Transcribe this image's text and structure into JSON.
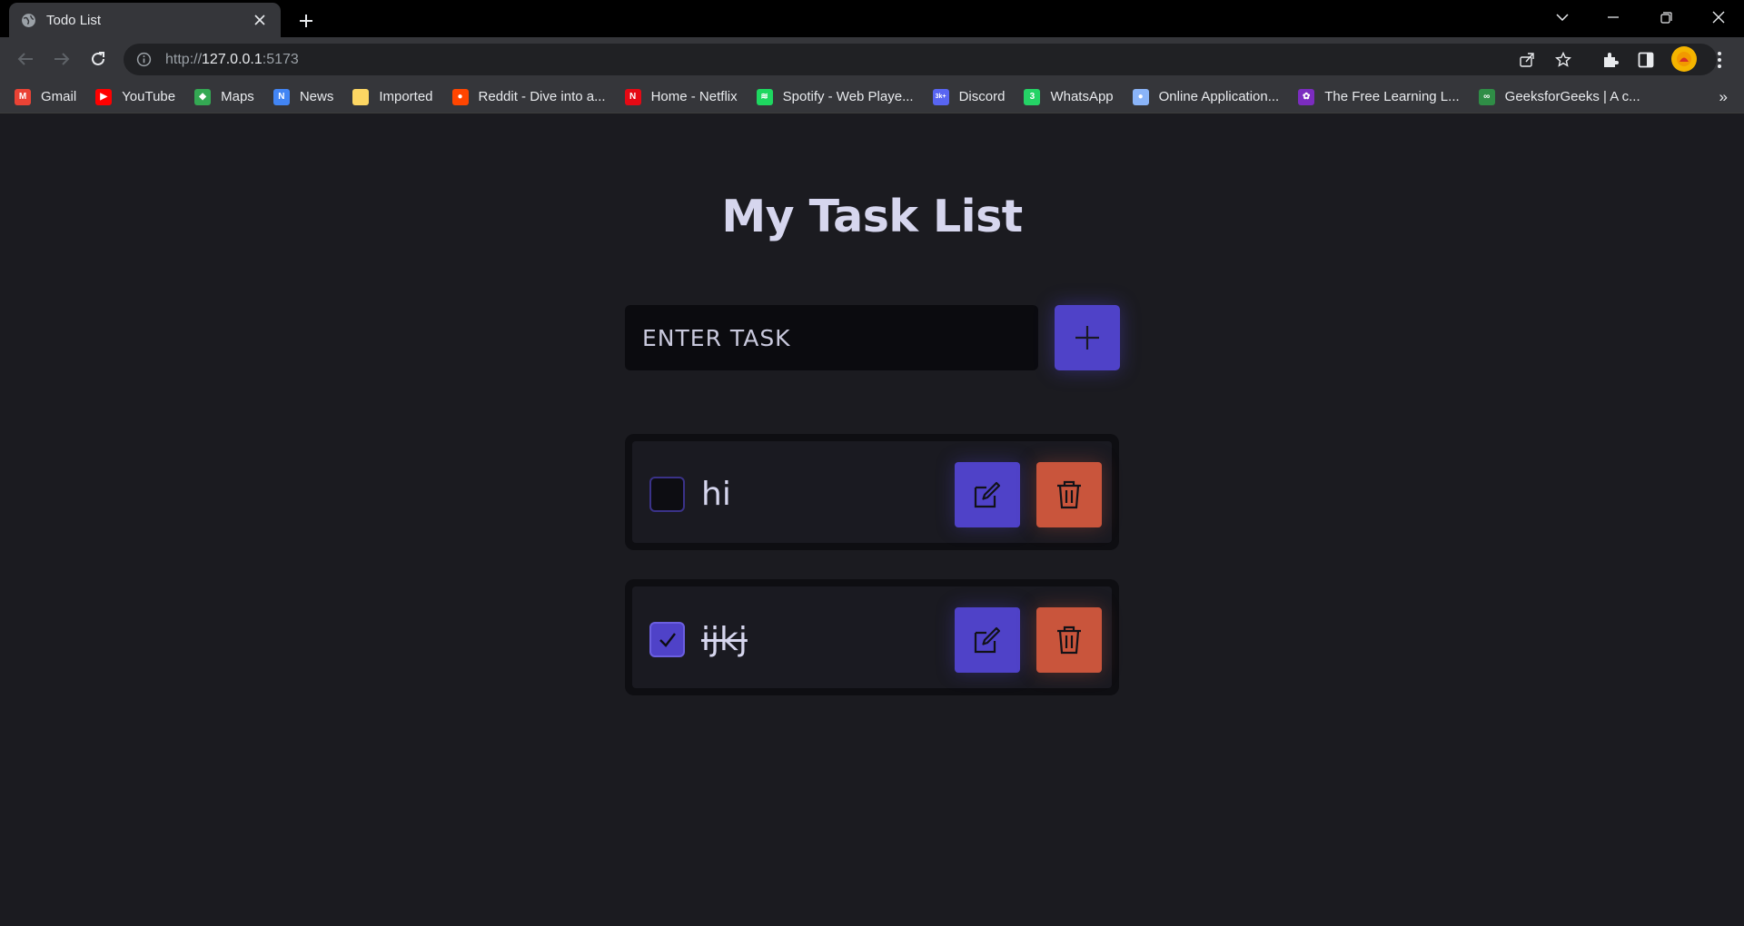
{
  "browser": {
    "tab_title": "Todo List",
    "url_scheme": "http://",
    "url_host": "127.0.0.1",
    "url_port": ":5173",
    "bookmarks": [
      {
        "label": "Gmail",
        "color": "#ea4335",
        "glyph": "M"
      },
      {
        "label": "YouTube",
        "color": "#ff0000",
        "glyph": "▶"
      },
      {
        "label": "Maps",
        "color": "#34a853",
        "glyph": "◆"
      },
      {
        "label": "News",
        "color": "#4285f4",
        "glyph": "N"
      },
      {
        "label": "Imported",
        "color": "#fdd663",
        "glyph": ""
      },
      {
        "label": "Reddit - Dive into a...",
        "color": "#ff4500",
        "glyph": "●"
      },
      {
        "label": "Home - Netflix",
        "color": "#e50914",
        "glyph": "N"
      },
      {
        "label": "Spotify - Web Playe...",
        "color": "#1ed760",
        "glyph": "≋"
      },
      {
        "label": "Discord",
        "color": "#5865f2",
        "glyph": "3k+"
      },
      {
        "label": "WhatsApp",
        "color": "#25d366",
        "glyph": "3"
      },
      {
        "label": "Online Application...",
        "color": "#8ab4f8",
        "glyph": "●"
      },
      {
        "label": "The Free Learning L...",
        "color": "#7b2cbf",
        "glyph": "✿"
      },
      {
        "label": "GeeksforGeeks | A c...",
        "color": "#2f8d46",
        "glyph": "∞"
      }
    ],
    "bookmarks_more": "»"
  },
  "app": {
    "title": "My Task List",
    "input_placeholder": "ENTER TASK",
    "colors": {
      "accent": "#4f42c8",
      "danger": "#c9553c",
      "background": "#1b1b20"
    },
    "tasks": [
      {
        "text": "hi",
        "completed": false
      },
      {
        "text": "ijkj",
        "completed": true
      }
    ]
  }
}
